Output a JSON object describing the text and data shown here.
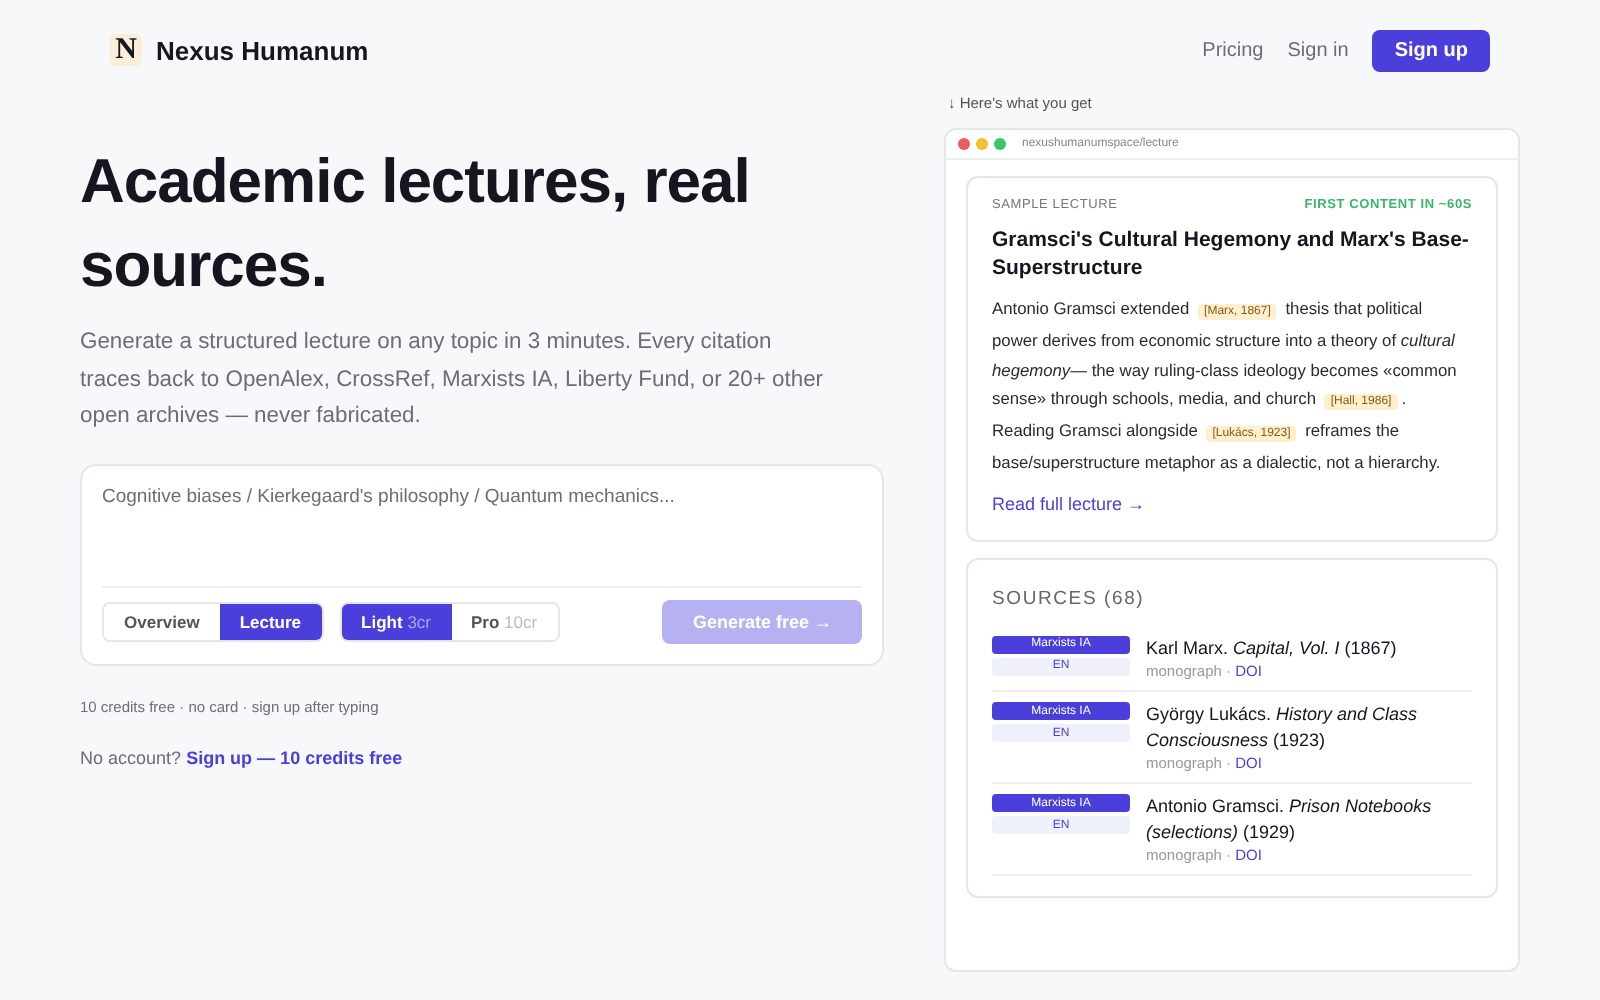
{
  "nav": {
    "brand": "Nexus Humanum",
    "logo_letter": "N",
    "links": [
      "Pricing",
      "Sign in"
    ],
    "cta": "Sign up"
  },
  "hero": {
    "title": "Academic lectures, real sources.",
    "subtitle": "Generate a structured lecture on any topic in 3 minutes. Every citation traces back to OpenAlex, CrossRef, Marxists IA, Liberty Fund, or 20+ other open archives — never fabricated."
  },
  "composer": {
    "placeholder": "Cognitive biases / Kierkegaard's philosophy / Quantum mechanics...",
    "modes": [
      {
        "label": "Overview",
        "selected": false
      },
      {
        "label": "Lecture",
        "selected": true
      }
    ],
    "tiers": [
      {
        "label": "Light",
        "cost": "3cr",
        "selected": true
      },
      {
        "label": "Pro",
        "cost": "10cr",
        "selected": false
      }
    ],
    "generate": {
      "label": "Generate free →",
      "disabled": true
    }
  },
  "note": "10 credits free · no card · sign up after typing",
  "account": {
    "text": "No account?",
    "link": "Sign up — 10 credits free"
  },
  "preview": {
    "caption": "↓ Here's what you get",
    "url": "nexushumanumspace/lecture",
    "lecture": {
      "eyebrow": "SAMPLE LECTURE",
      "badge": "FIRST CONTENT IN ~60S",
      "title": "Gramsci's Cultural Hegemony and Marx's Base-Superstructure",
      "body": [
        {
          "kind": "text",
          "text": "Antonio Gramsci extended "
        },
        {
          "kind": "cite",
          "text": "[Marx, 1867]"
        },
        {
          "kind": "text",
          "text": " thesis that political power derives from economic structure into a theory of *cultural hegemony*— the way ruling-class ideology becomes «common sense» through schools, media, and church "
        },
        {
          "kind": "cite",
          "text": "[Hall, 1986]"
        },
        {
          "kind": "text",
          "text": ". Reading Gramsci alongside "
        },
        {
          "kind": "cite",
          "text": "[Lukács, 1923]"
        },
        {
          "kind": "text",
          "text": " reframes the base/superstructure metaphor as a dialectic, not a hierarchy."
        }
      ],
      "link": "Read full lecture →"
    },
    "sources": {
      "heading": "SOURCES (68)",
      "items": [
        {
          "archive": "Marxists IA",
          "lang": "EN",
          "title": "Karl Marx. *Capital, Vol. I* (1867)",
          "type": "monograph · ",
          "link": "DOI"
        },
        {
          "archive": "Marxists IA",
          "lang": "EN",
          "title": "György Lukács. *History and Class Consciousness* (1923)",
          "type": "monograph · ",
          "link": "DOI"
        },
        {
          "archive": "Marxists IA",
          "lang": "EN",
          "title": "Antonio Gramsci. *Prison Notebooks (selections)* (1929)",
          "type": "monograph · ",
          "link": "DOI"
        }
      ]
    }
  }
}
